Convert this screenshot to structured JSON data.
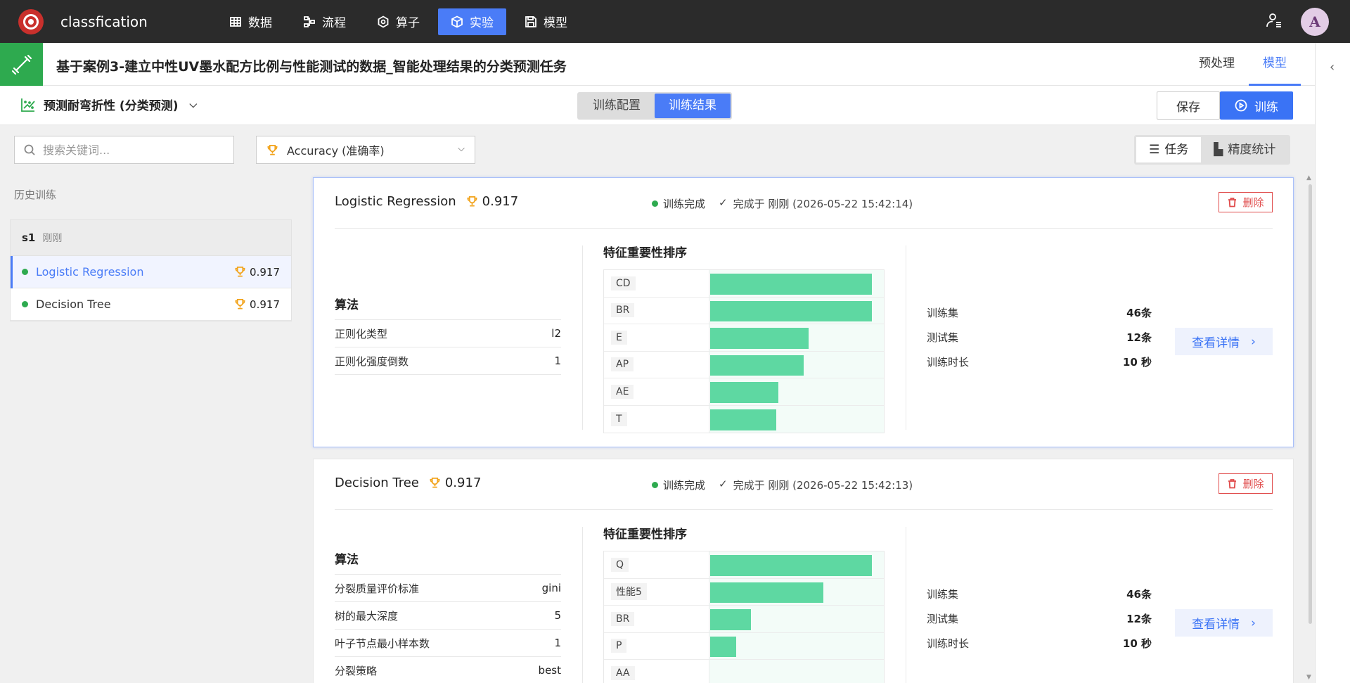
{
  "app": {
    "title": "classfication"
  },
  "nav": [
    {
      "label": "数据",
      "icon": "table-icon"
    },
    {
      "label": "流程",
      "icon": "flow-icon"
    },
    {
      "label": "算子",
      "icon": "operator-icon"
    },
    {
      "label": "实验",
      "icon": "cube-icon",
      "active": true
    },
    {
      "label": "模型",
      "icon": "save-icon"
    }
  ],
  "user": {
    "avatar_letter": "A"
  },
  "task": {
    "title": "基于案例3-建立中性UV墨水配方比例与性能测试的数据_智能处理结果的分类预测任务",
    "tabs": [
      {
        "label": "预处理"
      },
      {
        "label": "模型",
        "active": true
      }
    ]
  },
  "subbar": {
    "target_label": "预测耐弯折性 (分类预测)",
    "segments": [
      {
        "label": "训练配置"
      },
      {
        "label": "训练结果",
        "active": true
      }
    ],
    "save_label": "保存",
    "train_label": "训练"
  },
  "filters": {
    "search_placeholder": "搜索关键词...",
    "metric_label": "Accuracy (准确率)",
    "view_task_label": "任务",
    "view_stats_label": "精度统计"
  },
  "history": {
    "label": "历史训练",
    "group": {
      "name": "s1",
      "time": "刚刚"
    },
    "items": [
      {
        "name": "Logistic Regression",
        "score": "0.917",
        "active": true
      },
      {
        "name": "Decision Tree",
        "score": "0.917"
      }
    ]
  },
  "cards": [
    {
      "name": "Logistic Regression",
      "score": "0.917",
      "status": "训练完成",
      "done": "完成于 刚刚 (2026-05-22 15:42:14)",
      "delete_label": "删除",
      "algo_title": "算法",
      "params": [
        {
          "k": "正则化类型",
          "v": "l2"
        },
        {
          "k": "正则化强度倒数",
          "v": "1"
        }
      ],
      "fi_title": "特征重要性排序",
      "features": [
        {
          "label": "CD",
          "importance": 1.0
        },
        {
          "label": "BR",
          "importance": 1.0
        },
        {
          "label": "E",
          "importance": 0.61
        },
        {
          "label": "AP",
          "importance": 0.58
        },
        {
          "label": "AE",
          "importance": 0.42
        },
        {
          "label": "T",
          "importance": 0.41
        }
      ],
      "stats": [
        {
          "k": "训练集",
          "v": "46条"
        },
        {
          "k": "测试集",
          "v": "12条"
        },
        {
          "k": "训练时长",
          "v": "10 秒"
        }
      ],
      "detail_label": "查看详情"
    },
    {
      "name": "Decision Tree",
      "score": "0.917",
      "status": "训练完成",
      "done": "完成于 刚刚 (2026-05-22 15:42:13)",
      "delete_label": "删除",
      "algo_title": "算法",
      "params": [
        {
          "k": "分裂质量评价标准",
          "v": "gini"
        },
        {
          "k": "树的最大深度",
          "v": "5"
        },
        {
          "k": "叶子节点最小样本数",
          "v": "1"
        },
        {
          "k": "分裂策略",
          "v": "best"
        }
      ],
      "fi_title": "特征重要性排序",
      "features": [
        {
          "label": "Q",
          "importance": 1.0
        },
        {
          "label": "性能5",
          "importance": 0.7
        },
        {
          "label": "BR",
          "importance": 0.25
        },
        {
          "label": "P",
          "importance": 0.16
        },
        {
          "label": "AA",
          "importance": 0.0
        }
      ],
      "stats": [
        {
          "k": "训练集",
          "v": "46条"
        },
        {
          "k": "测试集",
          "v": "12条"
        },
        {
          "k": "训练时长",
          "v": "10 秒"
        }
      ],
      "detail_label": "查看详情"
    }
  ]
}
